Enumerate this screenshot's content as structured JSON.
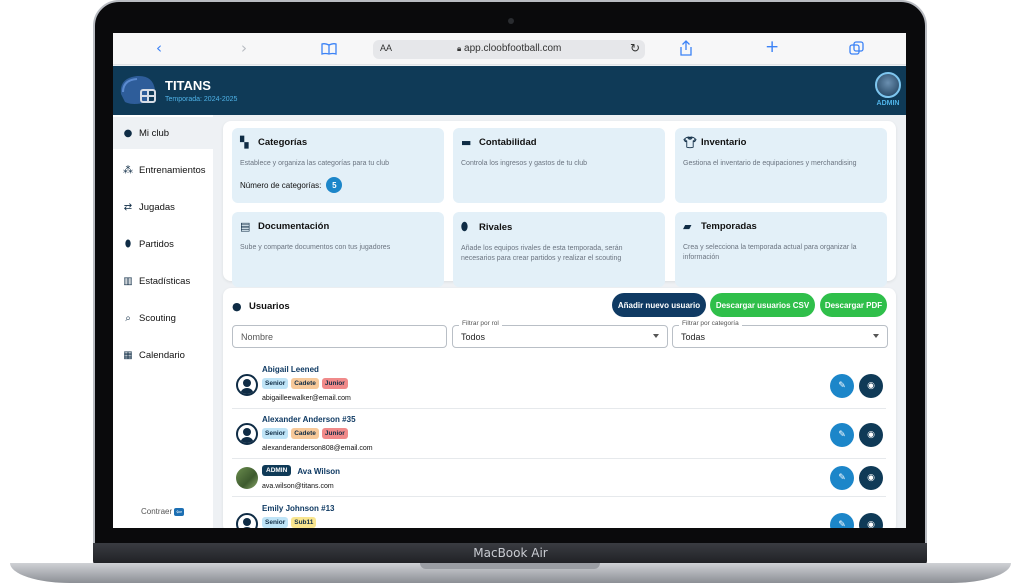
{
  "device": {
    "label": "MacBook Air"
  },
  "browser": {
    "text_size_label": "AA",
    "url": "app.cloobfootball.com",
    "icons": [
      "back-icon",
      "forward-icon",
      "book-icon",
      "lock-icon",
      "reload-icon",
      "share-icon",
      "new-tab-icon",
      "tabs-icon"
    ]
  },
  "header": {
    "team_name": "TITANS",
    "season": "Temporada: 2024-2025",
    "user_role": "ADMIN"
  },
  "sidebar": {
    "items": [
      {
        "label": "Mi club",
        "icon": "club-icon"
      },
      {
        "label": "Entrenamientos",
        "icon": "training-icon"
      },
      {
        "label": "Jugadas",
        "icon": "plays-icon"
      },
      {
        "label": "Partidos",
        "icon": "football-icon"
      },
      {
        "label": "Estadísticas",
        "icon": "bar-chart-icon"
      },
      {
        "label": "Scouting",
        "icon": "search-icon"
      },
      {
        "label": "Calendario",
        "icon": "calendar-icon"
      }
    ],
    "collapse_label": "Contraer"
  },
  "cards": [
    {
      "title": "Categorías",
      "desc": "Establece y organiza las categorías para tu club",
      "count_label": "Número de categorías:",
      "count": "5"
    },
    {
      "title": "Contabilidad",
      "desc": "Controla los ingresos y gastos de tu club"
    },
    {
      "title": "Inventario",
      "desc": "Gestiona el inventario de equipaciones y merchandising"
    },
    {
      "title": "Documentación",
      "desc": "Sube y comparte documentos con tus jugadores"
    },
    {
      "title": "Rivales",
      "desc": "Añade los equipos rivales de esta temporada, serán necesarios para crear partidos y realizar el scouting"
    },
    {
      "title": "Temporadas",
      "desc": "Crea y selecciona la temporada actual para organizar la información"
    }
  ],
  "users": {
    "title": "Usuarios",
    "buttons": {
      "add": "Añadir nuevo usuario",
      "csv": "Descargar usuarios CSV",
      "pdf": "Descargar PDF"
    },
    "filters": {
      "name_placeholder": "Nombre",
      "role_label": "Filtrar por rol",
      "role_value": "Todos",
      "category_label": "Filtrar por categoría",
      "category_value": "Todas"
    },
    "rows": [
      {
        "name": "Abigail Leened",
        "tags": [
          "Senior",
          "Cadete",
          "Junior"
        ],
        "email": "abigailleewalker@email.com"
      },
      {
        "name": "Alexander Anderson #35",
        "tags": [
          "Senior",
          "Cadete",
          "Junior"
        ],
        "email": "alexanderanderson808@email.com"
      },
      {
        "name": "Ava Wilson",
        "role": "ADMIN",
        "email": "ava.wilson@titans.com"
      },
      {
        "name": "Emily Johnson #13",
        "tags": [
          "Senior",
          "Sub11"
        ]
      }
    ]
  },
  "colors": {
    "header_bg": "#0f3a57",
    "accent_blue": "#1c86c9",
    "green": "#2fbf4a",
    "card_bg": "#e3f0f8"
  }
}
